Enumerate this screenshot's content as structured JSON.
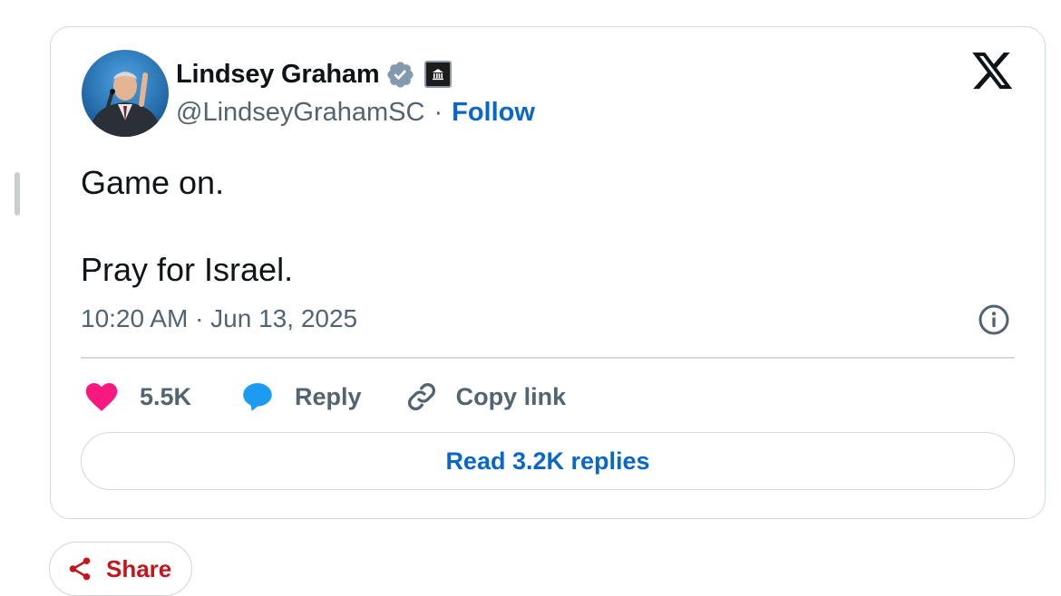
{
  "tweet": {
    "author_name": "Lindsey Graham",
    "handle": "@LindseyGrahamSC",
    "separator": "·",
    "follow_label": "Follow",
    "text_lines": [
      "Game on.",
      "Pray for Israel."
    ],
    "timestamp": "10:20 AM · Jun 13, 2025",
    "likes": "5.5K",
    "reply_label": "Reply",
    "copy_link_label": "Copy link",
    "read_replies_label": "Read 3.2K replies"
  },
  "share": {
    "label": "Share"
  },
  "icons": {
    "verified": "verified-badge-icon",
    "government": "government-badge-icon",
    "brand": "x-logo-icon",
    "info": "info-icon",
    "like": "heart-icon",
    "reply": "reply-bubble-icon",
    "copy": "link-icon",
    "share": "share-icon"
  },
  "colors": {
    "link_blue": "#0a67c8",
    "muted_text": "#536471",
    "like_pink": "#f91880",
    "reply_blue": "#1d9bf0",
    "share_red": "#c4161c",
    "border": "#cfd9de"
  }
}
